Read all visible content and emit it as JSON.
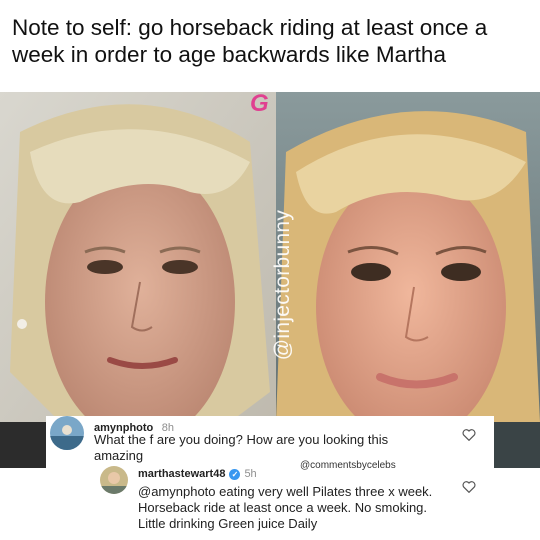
{
  "caption": "Note to self: go horseback riding at least once a week in order to age backwards like Martha",
  "watermark": "@injectorbunny",
  "brand_mark": "G",
  "comments": [
    {
      "username": "amynphoto",
      "time": "8h",
      "text": "What the f are you doing? How are you looking this amazing"
    },
    {
      "username": "marthastewart48",
      "time": "5h",
      "verified": true,
      "text": "@amynphoto eating very well  Pilates three x week. Horseback ride at least once a week.  No smoking. Little drinking  Green juice  Daily"
    }
  ],
  "credit": "@commentsbycelebs",
  "icons": [
    "heart-icon",
    "verified-badge-icon"
  ],
  "colors": {
    "verified": "#3897f0",
    "brand": "#e04090"
  }
}
